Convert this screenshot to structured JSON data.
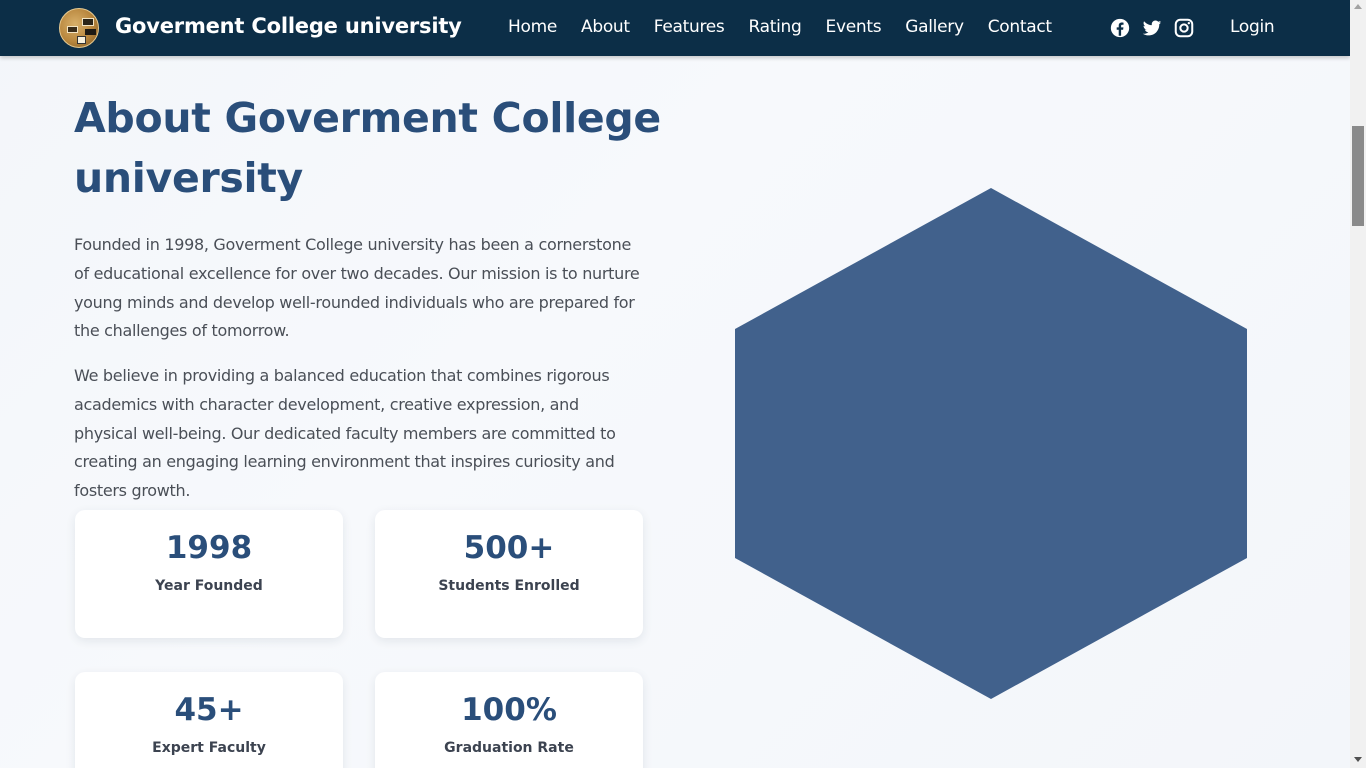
{
  "navbar": {
    "brand_title": "Goverment College university",
    "links": [
      "Home",
      "About",
      "Features",
      "Rating",
      "Events",
      "Gallery",
      "Contact"
    ],
    "social_icons": [
      "facebook-icon",
      "twitter-icon",
      "instagram-icon"
    ],
    "login_label": "Login"
  },
  "about": {
    "title": "About Goverment College university",
    "paragraph1": "Founded in 1998, Goverment College university has been a cornerstone of educational excellence for over two decades. Our mission is to nurture young minds and develop well-rounded individuals who are prepared for the challenges of tomorrow.",
    "paragraph2": "We believe in providing a balanced education that combines rigorous academics with character development, creative expression, and physical well-being. Our dedicated faculty members are committed to creating an engaging learning environment that inspires curiosity and fosters growth.",
    "stats": [
      {
        "value": "1998",
        "label": "Year Founded"
      },
      {
        "value": "500+",
        "label": "Students Enrolled"
      },
      {
        "value": "45+",
        "label": "Expert Faculty"
      },
      {
        "value": "100%",
        "label": "Graduation Rate"
      }
    ]
  },
  "colors": {
    "navbar": "#0c2e47",
    "heading": "#2a4e7a",
    "hexagon": "#41618c",
    "background": "#f5f8fb"
  }
}
